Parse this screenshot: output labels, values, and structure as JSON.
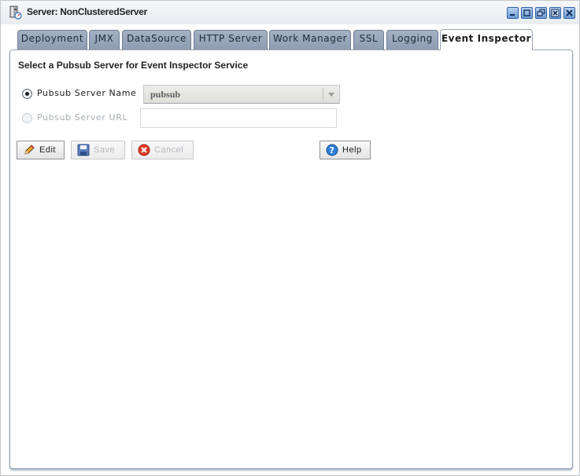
{
  "window": {
    "title": "Server: NonClusteredServer",
    "icon": "server-icon",
    "controls": [
      "minimize-icon",
      "maximize-icon",
      "restore-icon",
      "close-panel-icon",
      "close-icon"
    ]
  },
  "tabs": [
    {
      "label": "Deployment",
      "active": false
    },
    {
      "label": "JMX",
      "active": false
    },
    {
      "label": "DataSource",
      "active": false
    },
    {
      "label": "HTTP Server",
      "active": false
    },
    {
      "label": "Work Manager",
      "active": false
    },
    {
      "label": "SSL",
      "active": false
    },
    {
      "label": "Logging",
      "active": false
    },
    {
      "label": "Event Inspector",
      "active": true
    }
  ],
  "panel": {
    "section_title": "Select a Pubsub Server for Event Inspector Service",
    "options": {
      "server_name": {
        "label": "Pubsub Server Name",
        "selected": true,
        "value": "pubsub"
      },
      "server_url": {
        "label": "Pubsub Server URL",
        "selected": false,
        "enabled": false,
        "value": ""
      }
    },
    "buttons": {
      "edit": {
        "label": "Edit",
        "icon": "pencil-icon",
        "enabled": true
      },
      "save": {
        "label": "Save",
        "icon": "floppy-disk-icon",
        "enabled": false
      },
      "cancel": {
        "label": "Cancel",
        "icon": "cancel-icon",
        "enabled": false
      },
      "help": {
        "label": "Help",
        "icon": "help-icon",
        "enabled": true
      }
    }
  }
}
